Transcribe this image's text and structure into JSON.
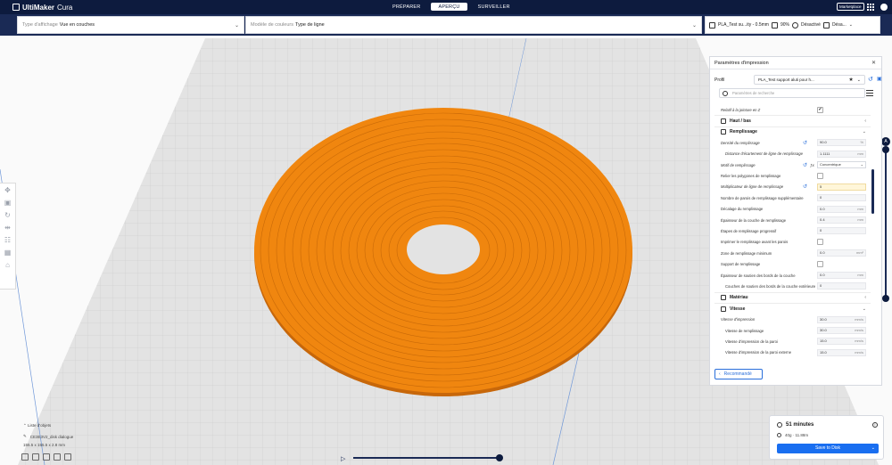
{
  "app": {
    "name_bold": "UltiMaker",
    "name_light": "Cura"
  },
  "stages": [
    "PRÉPARER",
    "APERÇU",
    "SURVEILLER"
  ],
  "marketplace": "Marketplace",
  "view_type": {
    "label": "Type d'affichage",
    "value": "Vue en couches"
  },
  "color_scheme": {
    "label": "Modèle de couleurs",
    "value": "Type de ligne"
  },
  "printer_bar": {
    "profile": "PLA_Test su...ity - 0.5mm",
    "infill": "90%",
    "support": "Désactivé",
    "adhesion": "Désa..."
  },
  "panel": {
    "title": "Paramètres d'impression",
    "profile_label": "Profil",
    "profile_value": "PLA_Test support aluti pour h...",
    "search_placeholder": "Paramètres de recherche",
    "rows": [
      {
        "label": "Relatif à la jointure en Z",
        "check": "✔",
        "italic": true
      },
      {
        "cat": "Haut / bas",
        "chev": "‹"
      },
      {
        "cat": "Remplissage",
        "chev": "⌄"
      },
      {
        "label": "Densité du remplissage",
        "value": "90.0",
        "unit": "%",
        "reset": true,
        "italic": true
      },
      {
        "label": "Distance d'écartement de ligne de remplissage",
        "value": "1.1111",
        "unit": "mm",
        "sub": true,
        "italic": true
      },
      {
        "label": "Motif de remplissage",
        "combo": "Concentrique",
        "reset": true,
        "fx": true,
        "italic": true
      },
      {
        "label": "Relier les polygones de remplissage",
        "check": ""
      },
      {
        "label": "Multiplicateur de ligne de remplissage",
        "value": "5",
        "unit": "",
        "reset": true,
        "italic": true,
        "hl": true
      },
      {
        "label": "Nombre de parois de remplissage supplémentaire",
        "value": "0",
        "unit": ""
      },
      {
        "label": "Décalage du remplissage",
        "value": "0.0",
        "unit": "mm"
      },
      {
        "label": "Épaisseur de la couche de remplissage",
        "value": "0.4",
        "unit": "mm"
      },
      {
        "label": "Étapes de remplissage progressif",
        "value": "0",
        "unit": ""
      },
      {
        "label": "Imprimer le remplissage avant les parois",
        "check": ""
      },
      {
        "label": "Zone de remplissage minimum",
        "value": "0.0",
        "unit": "mm²"
      },
      {
        "label": "Support de remplissage",
        "check": ""
      },
      {
        "label": "Épaisseur de soutien des bords de la couche",
        "value": "0.0",
        "unit": "mm"
      },
      {
        "label": "Couches de soutien des bords de la couche extérieure",
        "value": "0",
        "unit": "",
        "sub": true
      },
      {
        "cat": "Matériau",
        "chev": "‹"
      },
      {
        "cat": "Vitesse",
        "chev": "⌄"
      },
      {
        "label": "Vitesse d'impression",
        "value": "30.0",
        "unit": "mm/s",
        "italic": true
      },
      {
        "label": "Vitesse de remplissage",
        "value": "30.0",
        "unit": "mm/s",
        "sub": true
      },
      {
        "label": "Vitesse d'impression de la paroi",
        "value": "15.0",
        "unit": "mm/s",
        "sub": true
      },
      {
        "label": "Vitesse d'impression de la paroi externe",
        "value": "15.0",
        "unit": "mm/s",
        "sub": true
      }
    ],
    "recommended": "Recommandé"
  },
  "objects": {
    "title": "Liste d'objets",
    "name": "CE3E3V2_disk dialogue",
    "dims": "155.5 x 155.5 x 2.8 mm"
  },
  "layer_top": "A",
  "summary": {
    "time": "51 minutes",
    "material": "40g · 11.88m",
    "save": "Save to Disk"
  },
  "colors": {
    "topbar": "#0d1b3e",
    "model": "#f0860f",
    "accent": "#196ef0"
  }
}
